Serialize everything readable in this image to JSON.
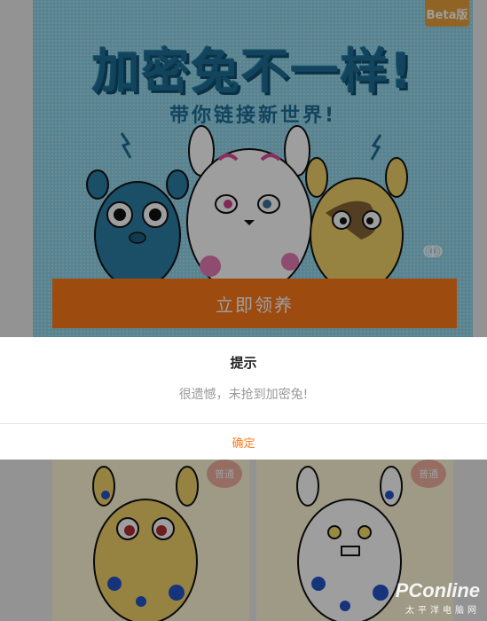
{
  "banner": {
    "beta_label": "Beta版",
    "title": "加密兔不一样!",
    "subtitle": "带你链接新世界!",
    "claim_button": "立即领养"
  },
  "cards": [
    {
      "badge": "普通"
    },
    {
      "badge": "普通"
    }
  ],
  "dialog": {
    "title": "提示",
    "message": "很遗憾，未抢到加密兔!",
    "confirm": "确定"
  },
  "watermark": {
    "main": "PConline",
    "sub": "太平洋电脑网"
  },
  "colors": {
    "accent": "#ff7a1a",
    "banner_bg": "#8fd6ec",
    "title_blue": "#1d6f96",
    "overlay": "rgba(0,0,0,0.38)"
  }
}
